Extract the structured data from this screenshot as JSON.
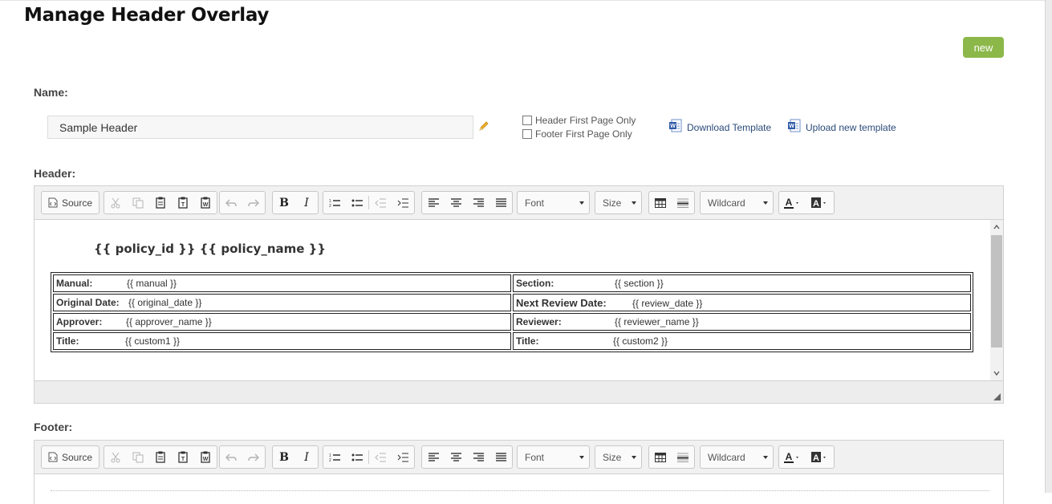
{
  "page": {
    "title": "Manage Header Overlay",
    "new_label": "new"
  },
  "form": {
    "name_label": "Name:",
    "name_value": "Sample Header",
    "header_first_page_only": "Header First Page Only",
    "footer_first_page_only": "Footer First Page Only",
    "download_template": "Download Template",
    "upload_template": "Upload new template"
  },
  "header_section": {
    "label": "Header:"
  },
  "footer_section": {
    "label": "Footer:"
  },
  "toolbar": {
    "source": "Source",
    "font": "Font",
    "size": "Size",
    "wildcard": "Wildcard"
  },
  "header_content": {
    "title": "{{ policy_id }} {{ policy_name }}",
    "rows": [
      {
        "left_key": "Manual:",
        "left_val": "{{ manual }}",
        "right_key": "Section:",
        "right_val": "{{ section }}"
      },
      {
        "left_key": "Original Date:",
        "left_val": "{{ original_date }}",
        "right_key": "Next Review Date:",
        "right_val": "{{ review_date }}"
      },
      {
        "left_key": "Approver:",
        "left_val": "{{ approver_name }}",
        "right_key": "Reviewer:",
        "right_val": "{{ reviewer_name }}"
      },
      {
        "left_key": "Title:",
        "left_val": "{{ custom1 }}",
        "right_key": "Title:",
        "right_val": "{{ custom2 }}"
      }
    ]
  },
  "colors": {
    "accent_green": "#8cb84a",
    "link_blue": "#2b4a7a"
  }
}
